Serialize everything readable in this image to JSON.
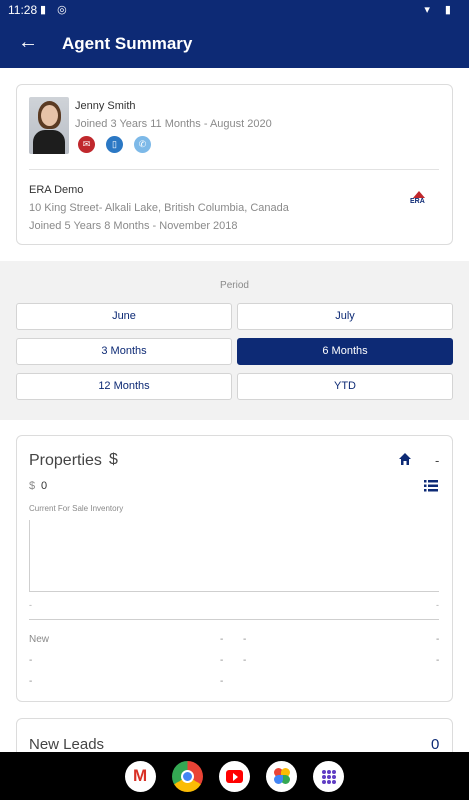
{
  "status_bar": {
    "time": "11:28"
  },
  "app_bar": {
    "back_icon": "arrow-left-icon",
    "title": "Agent Summary"
  },
  "agent": {
    "name": "Jenny Smith",
    "joined": "Joined 3 Years 11 Months - August 2020",
    "contact_icons": [
      "email-icon",
      "mobile-icon",
      "phone-icon"
    ]
  },
  "office": {
    "name": "ERA Demo",
    "address": "10 King Street- Alkali Lake,  British Columbia,  Canada",
    "joined": "Joined 5 Years 8 Months - November 2018",
    "logo_text": "ERA"
  },
  "period": {
    "label": "Period",
    "options": [
      "June",
      "July",
      "3 Months",
      "6 Months",
      "12 Months",
      "YTD"
    ],
    "selected": "6 Months"
  },
  "properties": {
    "title": "Properties",
    "currency_symbol": "$",
    "home_value": "-",
    "amount_currency": "$",
    "amount": "0",
    "inventory_label": "Current For Sale Inventory",
    "axis_start": "-",
    "axis_end": "-",
    "rows": [
      {
        "label": "New",
        "c1": "-",
        "c2": "-",
        "c3": "-"
      },
      {
        "label": "-",
        "c1": "-",
        "c2": "-",
        "c3": "-"
      },
      {
        "label": "-",
        "c1": "-"
      }
    ]
  },
  "new_leads": {
    "title": "New Leads",
    "value": "0"
  },
  "colors": {
    "primary": "#0d2a75",
    "accent_red": "#c0282d"
  }
}
